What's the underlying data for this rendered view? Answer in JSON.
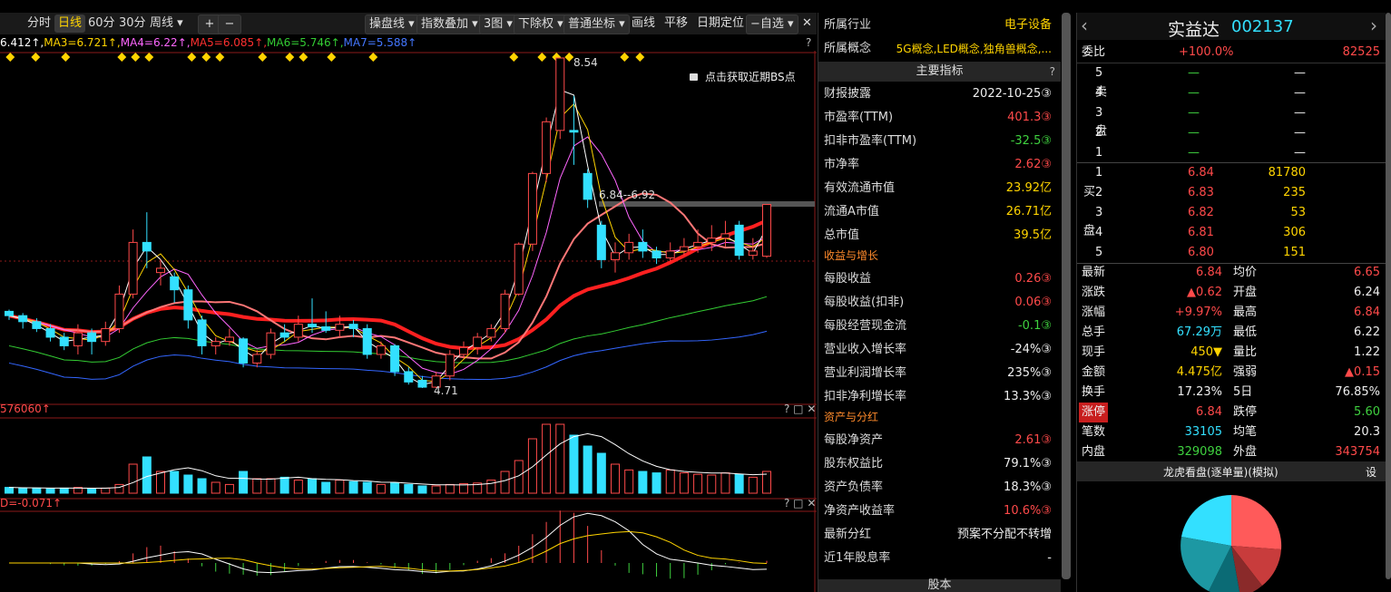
{
  "toolbar": {
    "tabs": [
      "分时",
      "日线",
      "60分",
      "30分",
      "周线 ▾"
    ],
    "active_tab": "日线",
    "zoom_in": "+",
    "zoom_out": "−",
    "buttons": [
      "操盘线 ▾",
      "指数叠加 ▾",
      "3图 ▾",
      "下除权 ▾",
      "普通坐标 ▾",
      "画线",
      "平移",
      "日期定位",
      "−自选 ▾"
    ],
    "close": "✕"
  },
  "ma_legend": {
    "ma2": "6.412↑,",
    "ma3": "MA3=6.721↑,",
    "ma4": "MA4=6.22↑,",
    "ma5": "MA5=6.085↑,",
    "ma6": "MA6=5.746↑,",
    "ma7": "MA7=5.588↑",
    "help": "?"
  },
  "chart": {
    "high_label": "8.54",
    "low_label": "4.71",
    "range_label": "6.84--6.92",
    "bs_hint": "点击获取近期BS点",
    "volume_label": "576060↑",
    "macd_label": "D=-0.071↑",
    "panel_controls": "? □ ✕",
    "colors": {
      "up": "#ff4a4a",
      "down": "#33e0ff",
      "ma_white": "#ffffff",
      "ma_yellow": "#ffd400",
      "ma_pink": "#ff66ff",
      "ma_red": "#ff2020",
      "ma_green": "#33cc33",
      "ma_blue": "#3366ff"
    }
  },
  "chart_data": {
    "type": "candlestick",
    "candles": [
      {
        "o": 5.6,
        "c": 5.55,
        "h": 5.62,
        "l": 5.5
      },
      {
        "o": 5.55,
        "c": 5.48,
        "h": 5.58,
        "l": 5.4
      },
      {
        "o": 5.48,
        "c": 5.4,
        "h": 5.52,
        "l": 5.36
      },
      {
        "o": 5.4,
        "c": 5.3,
        "h": 5.45,
        "l": 5.25
      },
      {
        "o": 5.3,
        "c": 5.2,
        "h": 5.35,
        "l": 5.15
      },
      {
        "o": 5.2,
        "c": 5.35,
        "h": 5.45,
        "l": 5.1
      },
      {
        "o": 5.35,
        "c": 5.25,
        "h": 5.4,
        "l": 5.1
      },
      {
        "o": 5.25,
        "c": 5.4,
        "h": 5.48,
        "l": 5.2
      },
      {
        "o": 5.4,
        "c": 5.8,
        "h": 5.9,
        "l": 5.35
      },
      {
        "o": 5.8,
        "c": 6.4,
        "h": 6.55,
        "l": 5.75
      },
      {
        "o": 6.4,
        "c": 6.3,
        "h": 6.75,
        "l": 6.1
      },
      {
        "o": 6.05,
        "c": 6.1,
        "h": 6.2,
        "l": 5.9
      },
      {
        "o": 6.0,
        "c": 5.85,
        "h": 6.05,
        "l": 5.7
      },
      {
        "o": 5.85,
        "c": 5.5,
        "h": 5.9,
        "l": 5.4
      },
      {
        "o": 5.5,
        "c": 5.2,
        "h": 5.55,
        "l": 5.1
      },
      {
        "o": 5.2,
        "c": 5.25,
        "h": 5.3,
        "l": 5.1
      },
      {
        "o": 5.25,
        "c": 5.3,
        "h": 5.4,
        "l": 5.2
      },
      {
        "o": 5.28,
        "c": 5.0,
        "h": 5.3,
        "l": 4.95
      },
      {
        "o": 5.0,
        "c": 5.1,
        "h": 5.15,
        "l": 4.95
      },
      {
        "o": 5.1,
        "c": 5.35,
        "h": 5.4,
        "l": 5.05
      },
      {
        "o": 5.35,
        "c": 5.3,
        "h": 5.45,
        "l": 5.25
      },
      {
        "o": 5.3,
        "c": 5.45,
        "h": 5.55,
        "l": 5.25
      },
      {
        "o": 5.45,
        "c": 5.42,
        "h": 5.75,
        "l": 5.35
      },
      {
        "o": 5.42,
        "c": 5.38,
        "h": 5.6,
        "l": 5.35
      },
      {
        "o": 5.38,
        "c": 5.45,
        "h": 5.55,
        "l": 5.3
      },
      {
        "o": 5.45,
        "c": 5.4,
        "h": 5.5,
        "l": 5.3
      },
      {
        "o": 5.4,
        "c": 5.1,
        "h": 5.45,
        "l": 5.05
      },
      {
        "o": 5.1,
        "c": 5.2,
        "h": 5.25,
        "l": 5.05
      },
      {
        "o": 5.2,
        "c": 4.9,
        "h": 5.22,
        "l": 4.85
      },
      {
        "o": 4.9,
        "c": 4.78,
        "h": 4.95,
        "l": 4.75
      },
      {
        "o": 4.8,
        "c": 4.72,
        "h": 4.85,
        "l": 4.71
      },
      {
        "o": 4.72,
        "c": 4.85,
        "h": 4.9,
        "l": 4.71
      },
      {
        "o": 4.85,
        "c": 5.1,
        "h": 5.15,
        "l": 4.8
      },
      {
        "o": 5.1,
        "c": 5.18,
        "h": 5.25,
        "l": 5.05
      },
      {
        "o": 5.18,
        "c": 5.3,
        "h": 5.35,
        "l": 5.1
      },
      {
        "o": 5.3,
        "c": 5.4,
        "h": 5.45,
        "l": 5.25
      },
      {
        "o": 5.4,
        "c": 5.8,
        "h": 5.85,
        "l": 5.35
      },
      {
        "o": 5.8,
        "c": 6.38,
        "h": 6.4,
        "l": 5.78
      },
      {
        "o": 6.38,
        "c": 7.2,
        "h": 7.22,
        "l": 6.3
      },
      {
        "o": 7.2,
        "c": 7.8,
        "h": 7.85,
        "l": 7.1
      },
      {
        "o": 7.7,
        "c": 8.54,
        "h": 8.54,
        "l": 7.6
      },
      {
        "o": 7.7,
        "c": 7.68,
        "h": 8.1,
        "l": 7.3
      },
      {
        "o": 7.2,
        "c": 6.9,
        "h": 7.25,
        "l": 6.8
      },
      {
        "o": 6.6,
        "c": 6.2,
        "h": 6.65,
        "l": 6.1
      },
      {
        "o": 6.2,
        "c": 6.28,
        "h": 6.4,
        "l": 6.05
      },
      {
        "o": 6.28,
        "c": 6.4,
        "h": 6.5,
        "l": 6.2
      },
      {
        "o": 6.4,
        "c": 6.3,
        "h": 6.55,
        "l": 6.22
      },
      {
        "o": 6.3,
        "c": 6.22,
        "h": 6.35,
        "l": 6.15
      },
      {
        "o": 6.22,
        "c": 6.3,
        "h": 6.4,
        "l": 6.18
      },
      {
        "o": 6.3,
        "c": 6.35,
        "h": 6.45,
        "l": 6.25
      },
      {
        "o": 6.35,
        "c": 6.4,
        "h": 6.55,
        "l": 6.28
      },
      {
        "o": 6.4,
        "c": 6.45,
        "h": 6.6,
        "l": 6.3
      },
      {
        "o": 6.45,
        "c": 6.5,
        "h": 6.65,
        "l": 6.35
      },
      {
        "o": 6.6,
        "c": 6.25,
        "h": 6.65,
        "l": 6.2
      },
      {
        "o": 6.25,
        "c": 6.3,
        "h": 6.45,
        "l": 6.2
      },
      {
        "o": 6.24,
        "c": 6.84,
        "h": 6.84,
        "l": 6.22
      }
    ],
    "volume": [
      0.08,
      0.07,
      0.07,
      0.06,
      0.07,
      0.08,
      0.06,
      0.07,
      0.12,
      0.4,
      0.5,
      0.3,
      0.3,
      0.25,
      0.2,
      0.15,
      0.12,
      0.3,
      0.2,
      0.2,
      0.22,
      0.18,
      0.2,
      0.15,
      0.18,
      0.16,
      0.15,
      0.12,
      0.14,
      0.12,
      0.1,
      0.1,
      0.12,
      0.13,
      0.14,
      0.18,
      0.3,
      0.45,
      0.75,
      0.95,
      0.95,
      0.8,
      0.65,
      0.55,
      0.4,
      0.32,
      0.3,
      0.28,
      0.32,
      0.28,
      0.26,
      0.25,
      0.28,
      0.26,
      0.22,
      0.3
    ],
    "high_price": 8.54,
    "low_price": 4.71
  },
  "fundamentals": {
    "industry_label": "所属行业",
    "industry_value": "电子设备",
    "concept_label": "所属概念",
    "concept_value": "5G概念,LED概念,独角兽概念,...",
    "main_header": "主要指标",
    "help": "?",
    "rows": [
      {
        "label": "财报披露",
        "value": "2022-10-25③",
        "cls": "white"
      },
      {
        "label": "市盈率(TTM)",
        "value": "401.3③",
        "cls": "red"
      },
      {
        "label": "扣非市盈率(TTM)",
        "value": "-32.5③",
        "cls": "green"
      },
      {
        "label": "市净率",
        "value": "2.62③",
        "cls": "red"
      },
      {
        "label": "有效流通市值",
        "value": "23.92亿",
        "cls": "yellow"
      },
      {
        "label": "流通A市值",
        "value": "26.71亿",
        "cls": "yellow"
      },
      {
        "label": "总市值",
        "value": "39.5亿",
        "cls": "yellow"
      }
    ],
    "section_growth": "收益与增长",
    "growth_rows": [
      {
        "label": "每股收益",
        "value": "0.26③",
        "cls": "red"
      },
      {
        "label": "每股收益(扣非)",
        "value": "0.06③",
        "cls": "red"
      },
      {
        "label": "每股经营现金流",
        "value": "-0.1③",
        "cls": "green"
      },
      {
        "label": "营业收入增长率",
        "value": "-24%③",
        "cls": "white"
      },
      {
        "label": "营业利润增长率",
        "value": "235%③",
        "cls": "white"
      },
      {
        "label": "扣非净利增长率",
        "value": "13.3%③",
        "cls": "white"
      }
    ],
    "section_assets": "资产与分红",
    "asset_rows": [
      {
        "label": "每股净资产",
        "value": "2.61③",
        "cls": "red"
      },
      {
        "label": "股东权益比",
        "value": "79.1%③",
        "cls": "white"
      },
      {
        "label": "资产负债率",
        "value": "18.3%③",
        "cls": "white"
      },
      {
        "label": "净资产收益率",
        "value": "10.6%③",
        "cls": "red"
      },
      {
        "label": "最新分红",
        "value": "预案不分配不转增",
        "cls": "white"
      },
      {
        "label": "近1年股息率",
        "value": "-",
        "cls": "white"
      }
    ],
    "bottom_header": "股本"
  },
  "quote": {
    "prev": "‹",
    "next": "›",
    "name": "实益达",
    "code": "002137",
    "weibi_label": "委比",
    "weibi_pct": "+100.0%",
    "weibi_vol": "82525",
    "sell_label": "卖盘",
    "buy_label": "买盘",
    "sell": [
      {
        "lvl": "5",
        "p": "—",
        "v": "—"
      },
      {
        "lvl": "4",
        "p": "—",
        "v": "—"
      },
      {
        "lvl": "3",
        "p": "—",
        "v": "—"
      },
      {
        "lvl": "2",
        "p": "—",
        "v": "—"
      },
      {
        "lvl": "1",
        "p": "—",
        "v": "—"
      }
    ],
    "buy": [
      {
        "lvl": "1",
        "p": "6.84",
        "v": "81780"
      },
      {
        "lvl": "2",
        "p": "6.83",
        "v": "235"
      },
      {
        "lvl": "3",
        "p": "6.82",
        "v": "53"
      },
      {
        "lvl": "4",
        "p": "6.81",
        "v": "306"
      },
      {
        "lvl": "5",
        "p": "6.80",
        "v": "151"
      }
    ],
    "stats": [
      {
        "l1": "最新",
        "v1": "6.84",
        "c1": "red",
        "l2": "均价",
        "v2": "6.65",
        "c2": "red"
      },
      {
        "l1": "涨跌",
        "v1": "▲0.62",
        "c1": "red",
        "l2": "开盘",
        "v2": "6.24",
        "c2": "white"
      },
      {
        "l1": "涨幅",
        "v1": "+9.97%",
        "c1": "red",
        "l2": "最高",
        "v2": "6.84",
        "c2": "red"
      },
      {
        "l1": "总手",
        "v1": "67.29万",
        "c1": "cyan",
        "l2": "最低",
        "v2": "6.22",
        "c2": "white"
      },
      {
        "l1": "现手",
        "v1": "450▼",
        "c1": "yellow",
        "l2": "量比",
        "v2": "1.22",
        "c2": "white"
      },
      {
        "l1": "金额",
        "v1": "4.475亿",
        "c1": "yellow",
        "l2": "强弱",
        "v2": "▲0.15",
        "c2": "red"
      },
      {
        "l1": "换手",
        "v1": "17.23%",
        "c1": "white",
        "l2": "5日",
        "v2": "76.85%",
        "c2": "white"
      },
      {
        "l1": "涨停",
        "v1": "6.84",
        "c1": "red",
        "l2": "跌停",
        "v2": "5.60",
        "c2": "green"
      },
      {
        "l1": "笔数",
        "v1": "33105",
        "c1": "cyan",
        "l2": "均笔",
        "v2": "20.3",
        "c2": "white"
      },
      {
        "l1": "内盘",
        "v1": "329098",
        "c1": "green",
        "l2": "外盘",
        "v2": "343754",
        "c2": "red"
      }
    ],
    "dragon_header": "龙虎看盘(逐单量)(模拟)",
    "dragon_setting": "设"
  }
}
